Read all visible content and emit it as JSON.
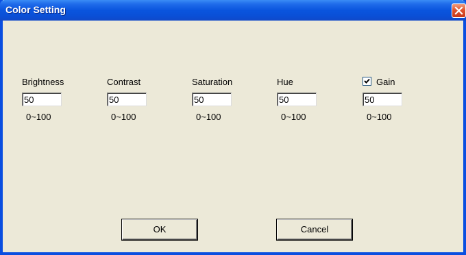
{
  "window": {
    "title": "Color Setting",
    "close_icon": "close-icon"
  },
  "fields": {
    "brightness": {
      "label": "Brightness",
      "value": "50",
      "range": "0~100"
    },
    "contrast": {
      "label": "Contrast",
      "value": "50",
      "range": "0~100"
    },
    "saturation": {
      "label": "Saturation",
      "value": "50",
      "range": "0~100"
    },
    "hue": {
      "label": "Hue",
      "value": "50",
      "range": "0~100"
    },
    "gain": {
      "label": "Gain",
      "value": "50",
      "range": "0~100",
      "checked": true
    }
  },
  "buttons": {
    "ok": "OK",
    "cancel": "Cancel"
  },
  "colors": {
    "titlebar": "#0a55de",
    "close_button": "#e0532c",
    "dialog_background": "#ece9d8"
  }
}
